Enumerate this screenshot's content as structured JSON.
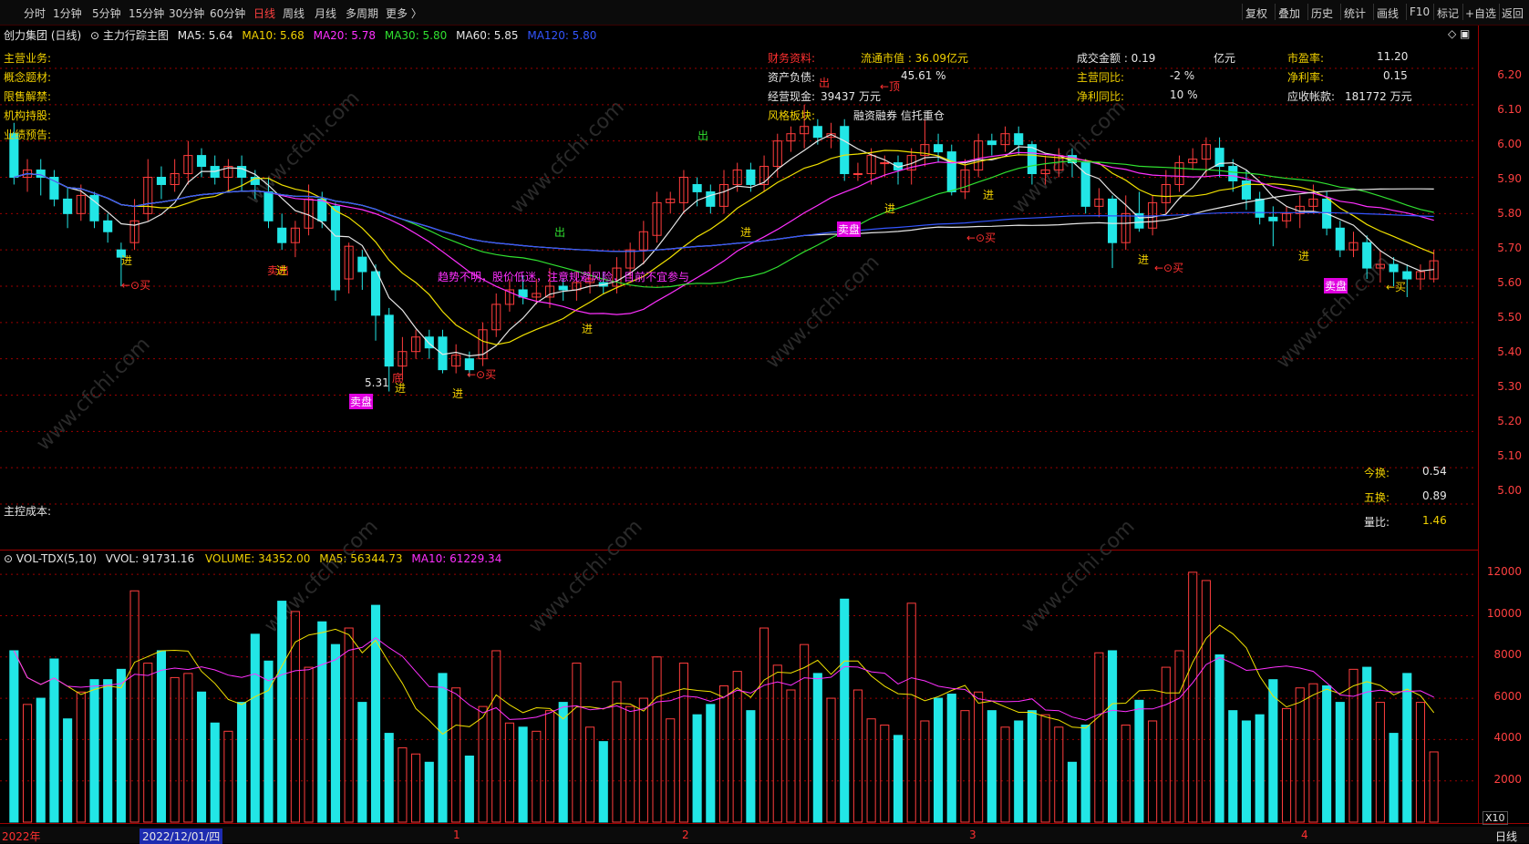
{
  "toolbar": {
    "periods": [
      "分时",
      "1分钟",
      "5分钟",
      "15分钟",
      "30分钟",
      "60分钟",
      "日线",
      "周线",
      "月线",
      "多周期",
      "更多 〉"
    ],
    "tools": [
      "复权",
      "叠加",
      "历史",
      "统计",
      "画线",
      "F10",
      "标记",
      "+自选",
      "返回"
    ]
  },
  "chart_header": {
    "stock": "创力集团 (日线)",
    "indicator": "主力行踪主图",
    "ma5": "MA5: 5.64",
    "ma10": "MA10: 5.68",
    "ma20": "MA20: 5.78",
    "ma30": "MA30: 5.80",
    "ma60": "MA60: 5.85",
    "ma120": "MA120: 5.80"
  },
  "info_left": [
    "主营业务:",
    "概念题材:",
    "限售解禁:",
    "机构持股:",
    "业绩预告:"
  ],
  "info_main_cost": "主控成本:",
  "fin": {
    "title": "财务资料:",
    "float_cap": "流通市值 : 36.09亿元",
    "turnover_amt": "成交金额 : 0.19",
    "unit_yi": "亿元",
    "pe_label": "市盈率:",
    "pe": "11.20",
    "debt_label": "资产负债:",
    "debt": "45.61 %",
    "rev_yoy_label": "主营同比:",
    "rev_yoy": "-2 %",
    "net_margin_label": "净利率:",
    "net_margin": "0.15",
    "cash_label": "经营现金:",
    "cash": "39437 万元",
    "profit_yoy_label": "净利同比:",
    "profit_yoy": "10 %",
    "recv_label": "应收帐款:",
    "recv": "181772 万元",
    "style_label": "风格板块:",
    "style": "融资融券  信托重仓"
  },
  "right_stats": {
    "today_turn_label": "今换:",
    "today_turn": "0.54",
    "five_turn_label": "五换:",
    "five_turn": "0.89",
    "vol_ratio_label": "量比:",
    "vol_ratio": "1.46"
  },
  "annotations": {
    "low_price": "5.31",
    "trend_msg": "趋势不明，股价低迷，注意规避风险，目前不宜参与",
    "enter": "进",
    "exit": "出",
    "buy": "←⊙买",
    "buy2": "←买",
    "top": "←顶",
    "bottom": "底",
    "sell": "卖出",
    "to_disk": "卖盘"
  },
  "price_axis": [
    "6.20",
    "6.10",
    "6.00",
    "5.90",
    "5.80",
    "5.70",
    "5.60",
    "5.50",
    "5.40",
    "5.30",
    "5.20",
    "5.10",
    "5.00"
  ],
  "volume_header": {
    "name": "VOL-TDX(5,10)",
    "vvol": "VVOL: 91731.16",
    "volume": "VOLUME: 34352.00",
    "ma5": "MA5: 56344.73",
    "ma10": "MA10: 61229.34"
  },
  "volume_axis": [
    "12000",
    "10000",
    "8000",
    "6000",
    "4000",
    "2000"
  ],
  "volume_unit": "X10",
  "time_axis": {
    "start": "2022年",
    "cursor": "2022/12/01/四",
    "months": [
      "1",
      "2",
      "3",
      "4"
    ],
    "period": "日线"
  },
  "watermark": "www.cfchi.com",
  "colors": {
    "up": "#ff3d3d",
    "down": "#22e6e6",
    "ma5": "#e6e6e6",
    "ma10": "#f0e000",
    "ma20": "#ff30ff",
    "ma30": "#30e030",
    "ma60": "#e6e6e6",
    "ma120": "#3355ff",
    "grid": "#9b0000"
  },
  "chart_data": {
    "type": "candlestick",
    "price_range": [
      5.0,
      6.25
    ],
    "volume_range": [
      0,
      12500
    ],
    "candles": [
      [
        6.02,
        5.9,
        6.05,
        5.88,
        8300
      ],
      [
        5.9,
        5.92,
        5.95,
        5.86,
        5700
      ],
      [
        5.92,
        5.9,
        5.95,
        5.85,
        6000
      ],
      [
        5.9,
        5.84,
        5.92,
        5.82,
        7900
      ],
      [
        5.84,
        5.8,
        5.87,
        5.76,
        5000
      ],
      [
        5.8,
        5.85,
        5.88,
        5.78,
        6300
      ],
      [
        5.85,
        5.78,
        5.86,
        5.76,
        6900
      ],
      [
        5.78,
        5.75,
        5.8,
        5.72,
        6900
      ],
      [
        5.7,
        5.68,
        5.72,
        5.6,
        7400
      ],
      [
        5.72,
        5.78,
        5.84,
        5.7,
        11200
      ],
      [
        5.8,
        5.9,
        5.95,
        5.78,
        7700
      ],
      [
        5.9,
        5.88,
        5.93,
        5.84,
        8300
      ],
      [
        5.88,
        5.91,
        5.95,
        5.86,
        7000
      ],
      [
        5.91,
        5.96,
        6.0,
        5.88,
        7200
      ],
      [
        5.96,
        5.93,
        5.98,
        5.9,
        6300
      ],
      [
        5.93,
        5.9,
        5.96,
        5.88,
        4800
      ],
      [
        5.9,
        5.93,
        5.95,
        5.86,
        4400
      ],
      [
        5.93,
        5.9,
        5.96,
        5.86,
        5800
      ],
      [
        5.9,
        5.88,
        5.92,
        5.84,
        9100
      ],
      [
        5.86,
        5.78,
        5.9,
        5.76,
        7800
      ],
      [
        5.76,
        5.72,
        5.8,
        5.7,
        10700
      ],
      [
        5.72,
        5.76,
        5.78,
        5.68,
        10200
      ],
      [
        5.76,
        5.84,
        5.88,
        5.74,
        7500
      ],
      [
        5.84,
        5.78,
        5.86,
        5.76,
        9700
      ],
      [
        5.82,
        5.59,
        5.83,
        5.56,
        8600
      ],
      [
        5.62,
        5.71,
        5.72,
        5.58,
        9400
      ],
      [
        5.68,
        5.64,
        5.7,
        5.59,
        5800
      ],
      [
        5.64,
        5.52,
        5.66,
        5.45,
        10500
      ],
      [
        5.52,
        5.38,
        5.54,
        5.31,
        4300
      ],
      [
        5.38,
        5.42,
        5.46,
        5.34,
        3600
      ],
      [
        5.42,
        5.46,
        5.48,
        5.4,
        3300
      ],
      [
        5.46,
        5.43,
        5.48,
        5.4,
        2900
      ],
      [
        5.46,
        5.37,
        5.48,
        5.36,
        7200
      ],
      [
        5.38,
        5.41,
        5.44,
        5.36,
        6500
      ],
      [
        5.4,
        5.37,
        5.42,
        5.35,
        3200
      ],
      [
        5.4,
        5.48,
        5.5,
        5.38,
        5600
      ],
      [
        5.48,
        5.55,
        5.58,
        5.46,
        8300
      ],
      [
        5.55,
        5.59,
        5.62,
        5.53,
        4800
      ],
      [
        5.59,
        5.57,
        5.63,
        5.55,
        4600
      ],
      [
        5.57,
        5.58,
        5.62,
        5.55,
        4400
      ],
      [
        5.57,
        5.6,
        5.65,
        5.54,
        5400
      ],
      [
        5.6,
        5.59,
        5.62,
        5.56,
        5800
      ],
      [
        5.59,
        5.61,
        5.64,
        5.56,
        7700
      ],
      [
        5.61,
        5.62,
        5.66,
        5.58,
        4600
      ],
      [
        5.61,
        5.6,
        5.64,
        5.58,
        3900
      ],
      [
        5.6,
        5.65,
        5.68,
        5.58,
        6800
      ],
      [
        5.65,
        5.7,
        5.72,
        5.62,
        5600
      ],
      [
        5.7,
        5.75,
        5.78,
        5.66,
        6000
      ],
      [
        5.74,
        5.83,
        5.86,
        5.72,
        8000
      ],
      [
        5.83,
        5.84,
        5.86,
        5.8,
        5000
      ],
      [
        5.83,
        5.9,
        5.92,
        5.8,
        7700
      ],
      [
        5.88,
        5.86,
        5.9,
        5.82,
        5200
      ],
      [
        5.86,
        5.82,
        5.88,
        5.8,
        5700
      ],
      [
        5.82,
        5.88,
        5.92,
        5.8,
        6600
      ],
      [
        5.88,
        5.92,
        5.94,
        5.86,
        7300
      ],
      [
        5.92,
        5.88,
        5.94,
        5.86,
        5400
      ],
      [
        5.88,
        5.93,
        5.96,
        5.86,
        9400
      ],
      [
        5.93,
        6.0,
        6.02,
        5.9,
        7600
      ],
      [
        6.0,
        6.02,
        6.04,
        5.97,
        6400
      ],
      [
        6.02,
        6.04,
        6.1,
        5.98,
        8600
      ],
      [
        6.04,
        6.01,
        6.06,
        5.99,
        7200
      ],
      [
        6.01,
        6.02,
        6.05,
        5.98,
        6000
      ],
      [
        6.04,
        5.91,
        6.06,
        5.89,
        10800
      ],
      [
        5.91,
        5.91,
        5.94,
        5.89,
        6400
      ],
      [
        5.91,
        5.96,
        5.98,
        5.88,
        5000
      ],
      [
        5.94,
        5.94,
        5.96,
        5.9,
        4700
      ],
      [
        5.94,
        5.92,
        5.96,
        5.88,
        4200
      ],
      [
        5.92,
        5.96,
        5.98,
        5.88,
        10600
      ],
      [
        5.96,
        5.99,
        6.06,
        5.93,
        4900
      ],
      [
        5.99,
        5.97,
        6.02,
        5.94,
        6000
      ],
      [
        5.97,
        5.86,
        5.99,
        5.85,
        6200
      ],
      [
        5.86,
        5.92,
        5.95,
        5.84,
        5400
      ],
      [
        5.92,
        6.0,
        6.02,
        5.9,
        6300
      ],
      [
        6.0,
        5.99,
        6.02,
        5.96,
        5400
      ],
      [
        5.99,
        6.02,
        6.04,
        5.97,
        4600
      ],
      [
        6.02,
        5.99,
        6.04,
        5.96,
        4900
      ],
      [
        5.99,
        5.91,
        6.0,
        5.88,
        5400
      ],
      [
        5.91,
        5.92,
        5.96,
        5.88,
        5200
      ],
      [
        5.92,
        5.96,
        5.98,
        5.9,
        4600
      ],
      [
        5.96,
        5.94,
        5.98,
        5.9,
        2900
      ],
      [
        5.94,
        5.82,
        5.95,
        5.8,
        4700
      ],
      [
        5.82,
        5.84,
        5.87,
        5.79,
        8200
      ],
      [
        5.84,
        5.72,
        5.85,
        5.65,
        8300
      ],
      [
        5.72,
        5.8,
        5.85,
        5.7,
        4700
      ],
      [
        5.8,
        5.76,
        5.86,
        5.75,
        5900
      ],
      [
        5.76,
        5.83,
        5.85,
        5.74,
        4900
      ],
      [
        5.83,
        5.88,
        5.92,
        5.8,
        7500
      ],
      [
        5.88,
        5.94,
        5.96,
        5.86,
        8300
      ],
      [
        5.94,
        5.95,
        5.98,
        5.92,
        12100
      ],
      [
        5.95,
        5.99,
        6.01,
        5.9,
        11700
      ],
      [
        5.98,
        5.93,
        6.01,
        5.9,
        8100
      ],
      [
        5.93,
        5.89,
        5.95,
        5.86,
        5400
      ],
      [
        5.89,
        5.84,
        5.92,
        5.81,
        4900
      ],
      [
        5.84,
        5.79,
        5.86,
        5.77,
        5200
      ],
      [
        5.79,
        5.78,
        5.82,
        5.71,
        6900
      ],
      [
        5.78,
        5.8,
        5.82,
        5.76,
        5500
      ],
      [
        5.8,
        5.82,
        5.85,
        5.76,
        6500
      ],
      [
        5.82,
        5.84,
        5.88,
        5.8,
        6700
      ],
      [
        5.84,
        5.76,
        5.86,
        5.74,
        6600
      ],
      [
        5.76,
        5.7,
        5.78,
        5.68,
        5800
      ],
      [
        5.7,
        5.72,
        5.75,
        5.68,
        7400
      ],
      [
        5.72,
        5.65,
        5.74,
        5.62,
        7500
      ],
      [
        5.65,
        5.66,
        5.7,
        5.61,
        5800
      ],
      [
        5.66,
        5.64,
        5.68,
        5.6,
        4300
      ],
      [
        5.64,
        5.62,
        5.66,
        5.57,
        7200
      ],
      [
        5.62,
        5.64,
        5.66,
        5.59,
        5800
      ],
      [
        5.62,
        5.67,
        5.7,
        5.61,
        3400
      ]
    ]
  }
}
